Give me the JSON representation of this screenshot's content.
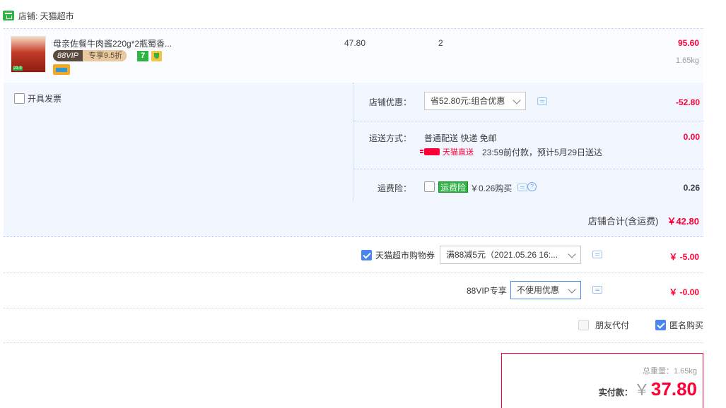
{
  "store": {
    "label": "店铺: 天猫超市"
  },
  "item": {
    "title": "母亲佐餐牛肉酱220g*2瓶蜀香...",
    "thumb_label": "23.9",
    "vip_left": "88VIP",
    "vip_right": "专享9.5折",
    "svc_seven": "7",
    "unit_price": "47.80",
    "qty": "2",
    "subtotal": "95.60",
    "weight": "1.65kg"
  },
  "invoice": {
    "label": "开具发票"
  },
  "shop_discount": {
    "label": "店铺优惠：",
    "selected": "省52.80元:组合优惠",
    "amount": "-52.80"
  },
  "shipping": {
    "label": "运送方式：",
    "method": "普通配送 快递 免邮",
    "tm_direct": "天猫直送",
    "eta": "23:59前付款，预计5月29日送达",
    "amount": "0.00"
  },
  "insurance": {
    "label": "运费险：",
    "tag": "运费险",
    "price": "￥0.26购买",
    "help": "?",
    "amount": "0.26"
  },
  "shop_total": {
    "label": "店铺合计(含运费)",
    "value": "￥42.80"
  },
  "coupon": {
    "label": "天猫超市购物券",
    "selected": "满88减5元（2021.05.26 16:...",
    "amount": "￥ -5.00"
  },
  "vip": {
    "label": "88VIP专享",
    "selected": "不使用优惠",
    "amount": "￥ -0.00"
  },
  "options": {
    "friend_pay": "朋友代付",
    "anonymous": "匿名购买"
  },
  "payment": {
    "weight": "总重量：1.65kg",
    "label": "实付款：",
    "currency": "￥",
    "amount": "37.80"
  },
  "colors": {
    "accent_red": "#ff0036",
    "brand_green": "#2eb344",
    "checkbox_blue": "#4a86f0"
  }
}
